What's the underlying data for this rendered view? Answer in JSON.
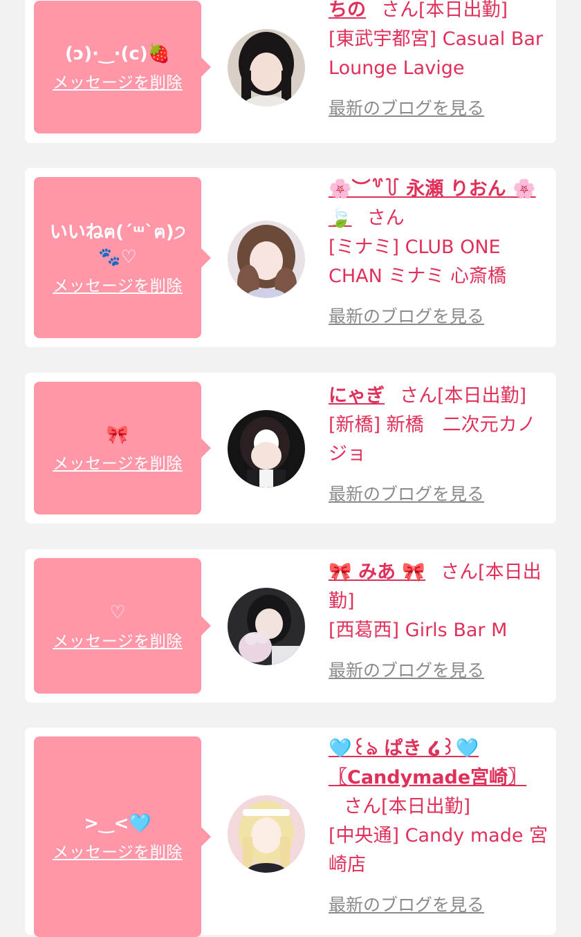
{
  "san_label": "さん",
  "delete_label": "メッセージを削除",
  "blog_label": "最新のブログを見る",
  "colors": {
    "background": "#f2f2f2",
    "card": "#ffffff",
    "bubble": "#ff97a8",
    "accent_text": "#e0305a",
    "muted_link": "#8a8a8a"
  },
  "entries": [
    {
      "message": "(ↄ)·‿·(c)🍓",
      "name": "ちの",
      "status": "[本日出勤]",
      "shop": "[東武宇都宮] Casual Bar Lounge Lavige",
      "avatar": "avatar-dark-hair"
    },
    {
      "message": "いいねฅ(´ᵚ`ฅ)੭ 🐾♡",
      "name": "🌸︶꒷꒦ 永瀬 りおん 🌸 🍃",
      "status": "",
      "shop": "[ミナミ] CLUB ONE CHAN ミナミ 心斎橋",
      "avatar": "avatar-brown-wavy"
    },
    {
      "message": "🎀",
      "name": "にゃぎ",
      "status": "[本日出勤]",
      "shop": "[新橋] 新橋　二次元カノジョ",
      "avatar": "avatar-maid"
    },
    {
      "message": "♡",
      "name": "🎀 みあ 🎀",
      "status": "[本日出勤]",
      "shop": "[西葛西] Girls Bar M",
      "avatar": "avatar-plush"
    },
    {
      "message": ">‿<🩵",
      "name": "🩵꒰ঌ ぱき ໒꒱🩵 〖Candymade宮崎〗",
      "status": "[本日出勤]",
      "shop": "[中央通] Candy made 宮崎店",
      "avatar": "avatar-blonde"
    }
  ]
}
